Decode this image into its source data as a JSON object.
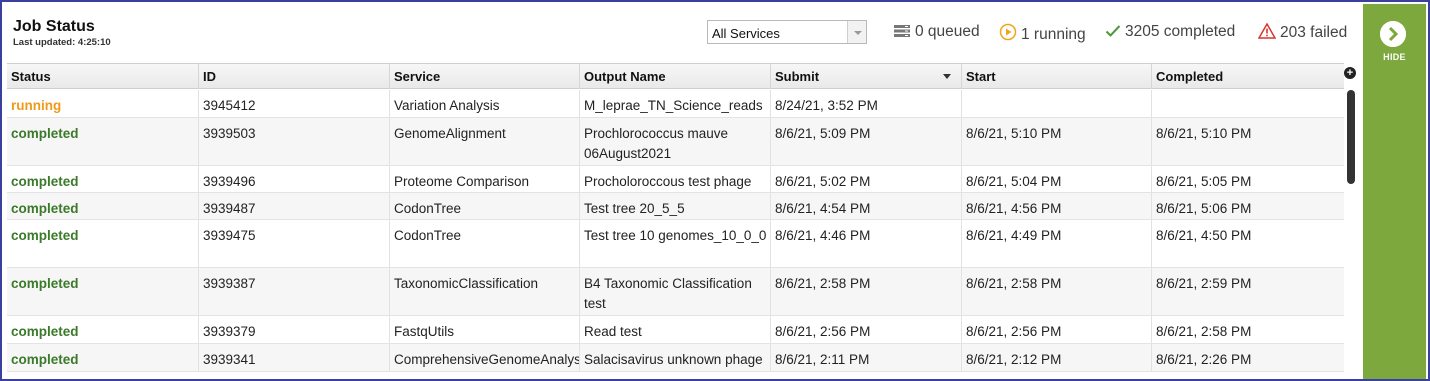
{
  "header": {
    "title": "Job Status",
    "last_updated": "Last updated: 4:25:10"
  },
  "filter": {
    "selected": "All Services"
  },
  "stats": {
    "queued": "0 queued",
    "running": "1 running",
    "completed": "3205 completed",
    "failed": "203 failed"
  },
  "columns": [
    "Status",
    "ID",
    "Service",
    "Output Name",
    "Submit",
    "Start",
    "Completed"
  ],
  "rows": [
    {
      "status": "running",
      "id": "3945412",
      "service": "Variation Analysis",
      "output": "M_leprae_TN_Science_reads",
      "submit": "8/24/21, 3:52 PM",
      "start": "",
      "completed": ""
    },
    {
      "status": "completed",
      "id": "3939503",
      "service": "GenomeAlignment",
      "output": "Prochlorococcus mauve 06August2021",
      "submit": "8/6/21, 5:09 PM",
      "start": "8/6/21, 5:10 PM",
      "completed": "8/6/21, 5:10 PM"
    },
    {
      "status": "completed",
      "id": "3939496",
      "service": "Proteome Comparison",
      "output": "Procholoroccous test phage",
      "submit": "8/6/21, 5:02 PM",
      "start": "8/6/21, 5:04 PM",
      "completed": "8/6/21, 5:05 PM"
    },
    {
      "status": "completed",
      "id": "3939487",
      "service": "CodonTree",
      "output": "Test tree 20_5_5",
      "submit": "8/6/21, 4:54 PM",
      "start": "8/6/21, 4:56 PM",
      "completed": "8/6/21, 5:06 PM"
    },
    {
      "status": "completed",
      "id": "3939475",
      "service": "CodonTree",
      "output": "Test tree 10 genomes_10_0_0",
      "submit": "8/6/21, 4:46 PM",
      "start": "8/6/21, 4:49 PM",
      "completed": "8/6/21, 4:50 PM"
    },
    {
      "status": "completed",
      "id": "3939387",
      "service": "TaxonomicClassification",
      "output": "B4 Taxonomic Classification test",
      "submit": "8/6/21, 2:58 PM",
      "start": "8/6/21, 2:58 PM",
      "completed": "8/6/21, 2:59 PM"
    },
    {
      "status": "completed",
      "id": "3939379",
      "service": "FastqUtils",
      "output": "Read test",
      "submit": "8/6/21, 2:56 PM",
      "start": "8/6/21, 2:56 PM",
      "completed": "8/6/21, 2:58 PM"
    },
    {
      "status": "completed",
      "id": "3939341",
      "service": "ComprehensiveGenomeAnalysis",
      "output": "Salacisavirus unknown phage",
      "submit": "8/6/21, 2:11 PM",
      "start": "8/6/21, 2:12 PM",
      "completed": "8/6/21, 2:26 PM"
    }
  ],
  "side": {
    "hide_label": "HIDE"
  },
  "colors": {
    "running": "#f09a1a",
    "completed": "#3a7a2a",
    "failed": "#d9352b",
    "panel": "#7ca83d"
  }
}
